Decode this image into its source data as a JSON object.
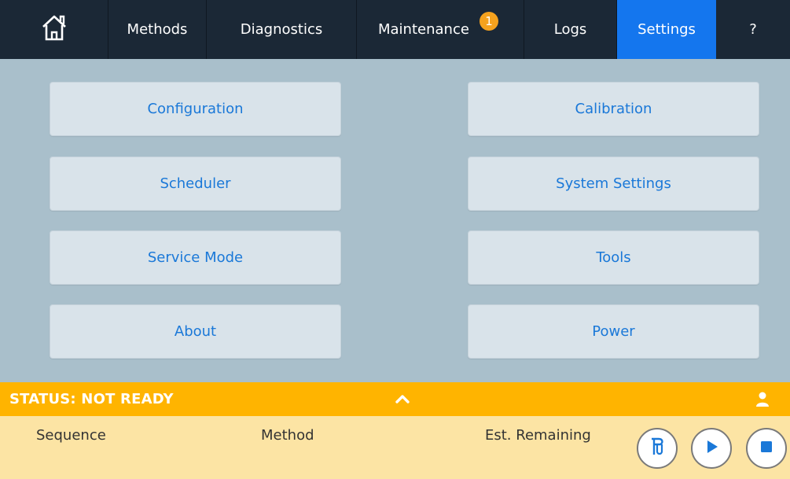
{
  "nav": {
    "tabs": {
      "methods": "Methods",
      "diagnostics": "Diagnostics",
      "maintenance": "Maintenance",
      "maintenance_badge": "1",
      "logs": "Logs",
      "settings": "Settings",
      "help": "?"
    },
    "active_tab": "Settings",
    "colors": {
      "bar": "#1b2836",
      "active": "#1476ee",
      "badge": "#f5a21e"
    }
  },
  "settings_menu": {
    "configuration": "Configuration",
    "calibration": "Calibration",
    "scheduler": "Scheduler",
    "system_settings": "System Settings",
    "service_mode": "Service Mode",
    "tools": "Tools",
    "about": "About",
    "power": "Power"
  },
  "status": {
    "text": "STATUS: NOT READY",
    "color": "#ffb400"
  },
  "info": {
    "sequence_label": "Sequence",
    "method_label": "Method",
    "remaining_label": "Est. Remaining"
  },
  "icons": {
    "home": "home-icon",
    "chevron": "chevron-up-icon",
    "user": "user-icon",
    "priority": "priority-sample-icon",
    "play": "play-icon",
    "stop": "stop-icon"
  }
}
